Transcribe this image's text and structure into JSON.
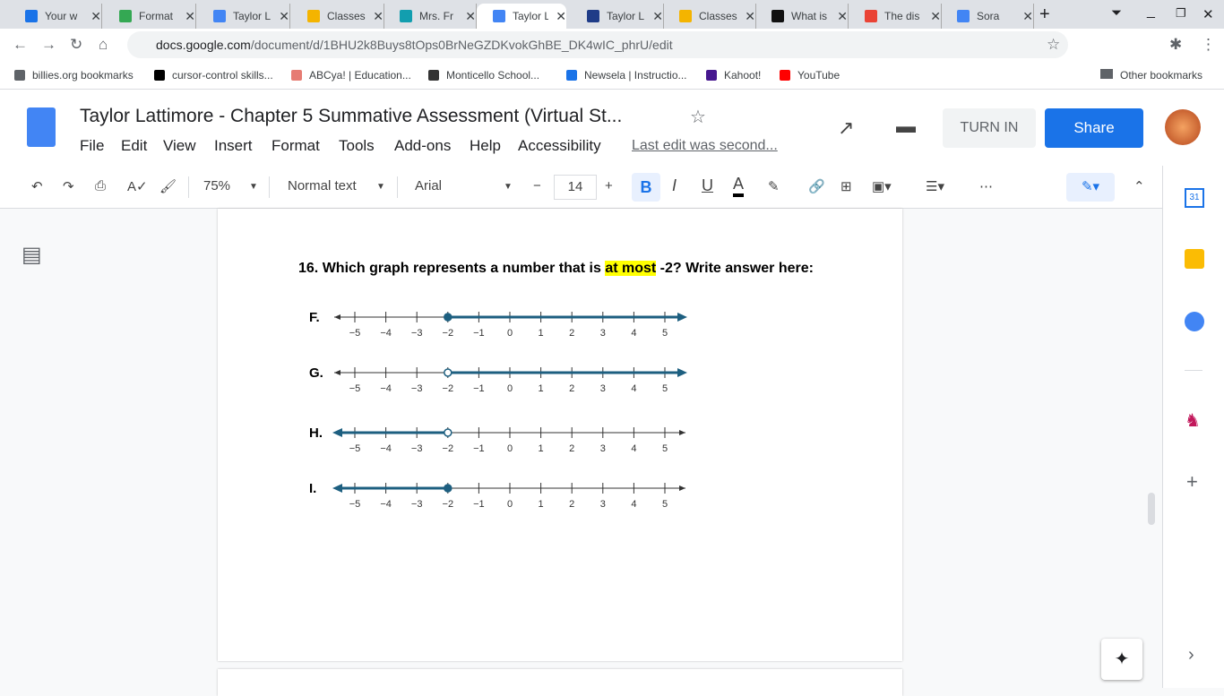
{
  "tabs": [
    {
      "title": "Your w",
      "color": "#1a73e8"
    },
    {
      "title": "Format",
      "color": "#34a853"
    },
    {
      "title": "Taylor L",
      "color": "#4285f4"
    },
    {
      "title": "Classes",
      "color": "#f4b400"
    },
    {
      "title": "Mrs. Fr",
      "color": "#129eaf"
    },
    {
      "title": "Taylor L",
      "color": "#4285f4",
      "active": true
    },
    {
      "title": "Taylor L",
      "color": "#1f3c88"
    },
    {
      "title": "Classes",
      "color": "#f4b400"
    },
    {
      "title": "What is",
      "color": "#111"
    },
    {
      "title": "The dis",
      "color": "#ea4335"
    },
    {
      "title": "Sora",
      "color": "#4285f4"
    }
  ],
  "url_host": "docs.google.com",
  "url_path": "/document/d/1BHU2k8Buys8tOps0BrNeGZDKvokGhBE_DK4wIC_phrU/edit",
  "bookmarks": [
    "billies.org bookmarks",
    "cursor-control skills...",
    "ABCya! | Education...",
    "Monticello School...",
    "Newsela | Instructio...",
    "Kahoot!",
    "YouTube"
  ],
  "other_bookmarks": "Other bookmarks",
  "doc_title": "Taylor Lattimore -  Chapter 5 Summative Assessment (Virtual St...",
  "menus": [
    "File",
    "Edit",
    "View",
    "Insert",
    "Format",
    "Tools",
    "Add-ons",
    "Help",
    "Accessibility"
  ],
  "last_edit": "Last edit was second...",
  "turn_in": "TURN IN",
  "share": "Share",
  "toolbar": {
    "zoom": "75%",
    "style": "Normal text",
    "font": "Arial",
    "size": "14"
  },
  "question": {
    "pre": "16.  Which graph represents a number that is ",
    "highlight": "at most",
    "post": " -2? Write answer here:"
  },
  "chart_data": {
    "type": "number-line",
    "ticks": [
      -5,
      -4,
      -3,
      -2,
      -1,
      0,
      1,
      2,
      3,
      4,
      5
    ],
    "tick_labels": [
      "−5",
      "−4",
      "−3",
      "−2",
      "−1",
      "0",
      "1",
      "2",
      "3",
      "4",
      "5"
    ],
    "options": [
      {
        "label": "F.",
        "point": -2,
        "closed": true,
        "direction": "right"
      },
      {
        "label": "G.",
        "point": -2,
        "closed": false,
        "direction": "right"
      },
      {
        "label": "H.",
        "point": -2,
        "closed": false,
        "direction": "left"
      },
      {
        "label": "I.",
        "point": -2,
        "closed": true,
        "direction": "left"
      }
    ],
    "color": "#1d5f80"
  }
}
